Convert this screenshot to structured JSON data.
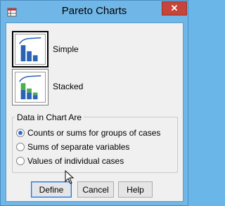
{
  "window": {
    "title": "Pareto Charts",
    "close_glyph": "✕",
    "app_icon": "spss-dialog-icon"
  },
  "chart_types": [
    {
      "label": "Simple",
      "selected": true,
      "icon": "pareto-simple-chart-icon"
    },
    {
      "label": "Stacked",
      "selected": false,
      "icon": "pareto-stacked-chart-icon"
    }
  ],
  "data_group": {
    "legend": "Data in Chart Are",
    "options": [
      {
        "label": "Counts or sums for groups of cases",
        "checked": true
      },
      {
        "label": "Sums of separate variables",
        "checked": false
      },
      {
        "label": "Values of individual cases",
        "checked": false
      }
    ]
  },
  "buttons": {
    "define": "Define",
    "cancel": "Cancel",
    "help": "Help"
  },
  "colors": {
    "titlebar": "#70b6e6",
    "close": "#c7443a",
    "bar_blue": "#2a62b4",
    "bar_green": "#4cae4c",
    "radio_dot": "#2f6fc9"
  }
}
